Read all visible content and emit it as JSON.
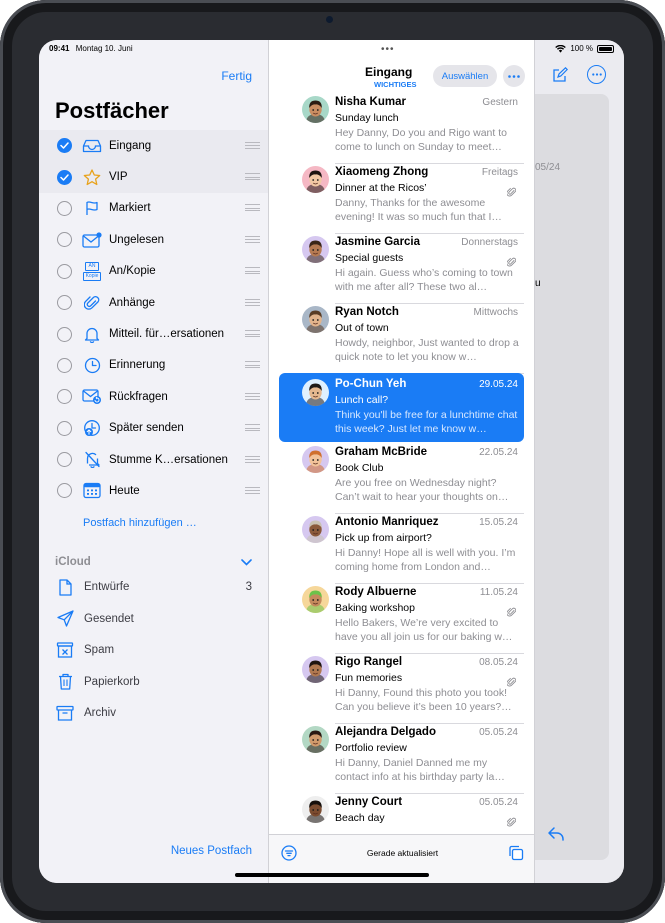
{
  "status": {
    "time": "09:41",
    "date": "Montag 10. Juni",
    "battery": "100 %"
  },
  "sidebar": {
    "done": "Fertig",
    "title": "Postfächer",
    "mailboxes": [
      {
        "label": "Eingang",
        "checked": true,
        "icon": "inbox-icon"
      },
      {
        "label": "VIP",
        "checked": true,
        "icon": "star-icon"
      },
      {
        "label": "Markiert",
        "checked": false,
        "icon": "flag-icon"
      },
      {
        "label": "Ungelesen",
        "checked": false,
        "icon": "unread-envelope-icon"
      },
      {
        "label": "An/Kopie",
        "checked": false,
        "icon": "to-cc-icon",
        "icon_text": [
          "AN",
          "Kopie"
        ]
      },
      {
        "label": "Anhänge",
        "checked": false,
        "icon": "paperclip-icon"
      },
      {
        "label": "Mitteil. für…ersationen",
        "checked": false,
        "icon": "bell-icon"
      },
      {
        "label": "Erinnerung",
        "checked": false,
        "icon": "clock-icon"
      },
      {
        "label": "Rückfragen",
        "checked": false,
        "icon": "follow-up-envelope-icon"
      },
      {
        "label": "Später senden",
        "checked": false,
        "icon": "send-later-icon"
      },
      {
        "label": "Stumme K…ersationen",
        "checked": false,
        "icon": "bell-slash-icon"
      },
      {
        "label": "Heute",
        "checked": false,
        "icon": "calendar-icon"
      }
    ],
    "add_mailbox": "Postfach hinzufügen …",
    "icloud": {
      "title": "iCloud",
      "folders": [
        {
          "label": "Entwürfe",
          "count": "3",
          "icon": "document-icon"
        },
        {
          "label": "Gesendet",
          "count": "",
          "icon": "paperplane-icon"
        },
        {
          "label": "Spam",
          "count": "",
          "icon": "junk-icon"
        },
        {
          "label": "Papierkorb",
          "count": "",
          "icon": "trash-icon"
        },
        {
          "label": "Archiv",
          "count": "",
          "icon": "archive-icon"
        }
      ]
    },
    "new_mailbox": "Neues Postfach"
  },
  "list": {
    "title": "Eingang",
    "subtitle": "WICHTIGES",
    "select": "Auswählen",
    "status": "Gerade aktualisiert",
    "messages": [
      {
        "sender": "Nisha Kumar",
        "date": "Gestern",
        "subject": "Sunday lunch",
        "preview": "Hey Danny, Do you and Rigo want to come to lunch on Sunday to meet…",
        "attachment": false,
        "selected": false,
        "avatar_color": "#a8d8c8",
        "skin": "#c98d62",
        "hair": "#2b1b12"
      },
      {
        "sender": "Xiaomeng Zhong",
        "date": "Freitags",
        "subject": "Dinner at the Ricos’",
        "preview": "Danny, Thanks for the awesome evening! It was so much fun that I…",
        "attachment": true,
        "selected": false,
        "avatar_color": "#f5b8c4",
        "skin": "#f1c8a4",
        "hair": "#1d1410"
      },
      {
        "sender": "Jasmine Garcia",
        "date": "Donnerstags",
        "subject": "Special guests",
        "preview": "Hi again. Guess who’s coming to town with me after all? These two al…",
        "attachment": true,
        "selected": false,
        "avatar_color": "#d6c8f0",
        "skin": "#b57a52",
        "hair": "#3a2618"
      },
      {
        "sender": "Ryan Notch",
        "date": "Mittwochs",
        "subject": "Out of town",
        "preview": "Howdy, neighbor, Just wanted to drop a quick note to let you know w…",
        "attachment": false,
        "selected": false,
        "avatar_color": "#a9b7c7",
        "skin": "#e2b48c",
        "hair": "#5a3d25"
      },
      {
        "sender": "Po-Chun Yeh",
        "date": "29.05.24",
        "subject": "Lunch call?",
        "preview": "Think you'll be free for a lunchtime chat this week? Just let me know w…",
        "attachment": false,
        "selected": true,
        "avatar_color": "#dff0ff",
        "skin": "#e6b88f",
        "hair": "#1f1a17"
      },
      {
        "sender": "Graham McBride",
        "date": "22.05.24",
        "subject": "Book Club",
        "preview": "Are you free on Wednesday night? Can’t wait to hear your thoughts on…",
        "attachment": false,
        "selected": false,
        "avatar_color": "#d6c8f0",
        "skin": "#f2c39a",
        "hair": "#d0702e"
      },
      {
        "sender": "Antonio Manriquez",
        "date": "15.05.24",
        "subject": "Pick up from airport?",
        "preview": "Hi Danny! Hope all is well with you. I’m coming home from London and…",
        "attachment": false,
        "selected": false,
        "avatar_color": "#d6c8f0",
        "skin": "#8a5a3b",
        "hair": "#c9c2b4"
      },
      {
        "sender": "Rody Albuerne",
        "date": "11.05.24",
        "subject": "Baking workshop",
        "preview": "Hello Bakers, We’re very excited to have you all join us for our baking w…",
        "attachment": true,
        "selected": false,
        "avatar_color": "#f6d79a",
        "skin": "#c48a5d",
        "hair": "#6cc24a"
      },
      {
        "sender": "Rigo Rangel",
        "date": "08.05.24",
        "subject": "Fun memories",
        "preview": "Hi Danny, Found this photo you took! Can you believe it’s been 10 years?…",
        "attachment": true,
        "selected": false,
        "avatar_color": "#d6c8f0",
        "skin": "#b07850",
        "hair": "#1e1410"
      },
      {
        "sender": "Alejandra Delgado",
        "date": "05.05.24",
        "subject": "Portfolio review",
        "preview": "Hi Danny, Daniel Danned me my contact info at his birthday party la…",
        "attachment": false,
        "selected": false,
        "avatar_color": "#b3d8c4",
        "skin": "#d09a6c",
        "hair": "#2a1912"
      },
      {
        "sender": "Jenny Court",
        "date": "05.05.24",
        "subject": "Beach day",
        "preview": "",
        "attachment": true,
        "selected": false,
        "avatar_color": "#eeeeee",
        "skin": "#7b4c30",
        "hair": "#17100c"
      }
    ]
  },
  "detail": {
    "date_fragment": "05/24",
    "text_fragment": "u"
  }
}
